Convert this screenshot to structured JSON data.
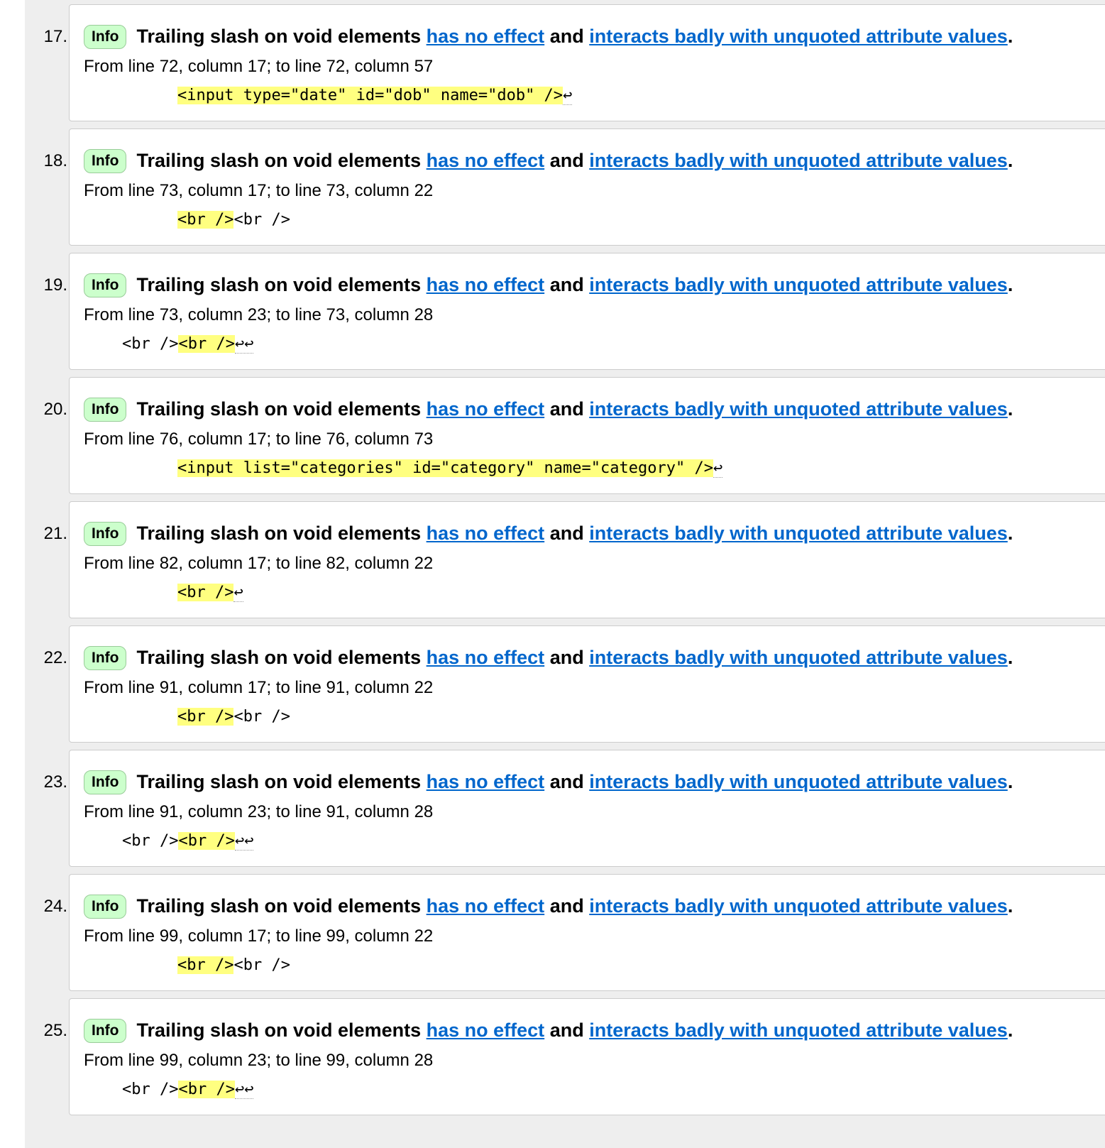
{
  "messages": [
    {
      "number": "17.",
      "badge": "Info",
      "text_prefix": "Trailing slash on void elements",
      "link1": "has no effect",
      "text_mid": "and",
      "link2": "interacts badly with unquoted attribute values",
      "text_suffix": ".",
      "location": "From line 72, column 17; to line 72, column 57",
      "extract_before": "",
      "extract_highlight": "<input type=\"date\" id=\"dob\" name=\"dob\" />",
      "extract_after": "↩"
    },
    {
      "number": "18.",
      "badge": "Info",
      "text_prefix": "Trailing slash on void elements",
      "link1": "has no effect",
      "text_mid": "and",
      "link2": "interacts badly with unquoted attribute values",
      "text_suffix": ".",
      "location": "From line 73, column 17; to line 73, column 22",
      "extract_before": "",
      "extract_highlight": "<br />",
      "extract_after": "<br />"
    },
    {
      "number": "19.",
      "badge": "Info",
      "text_prefix": "Trailing slash on void elements",
      "link1": "has no effect",
      "text_mid": "and",
      "link2": "interacts badly with unquoted attribute values",
      "text_suffix": ".",
      "location": "From line 73, column 23; to line 73, column 28",
      "extract_before": "<br />",
      "extract_highlight": "<br />",
      "extract_after": "↩↩"
    },
    {
      "number": "20.",
      "badge": "Info",
      "text_prefix": "Trailing slash on void elements",
      "link1": "has no effect",
      "text_mid": "and",
      "link2": "interacts badly with unquoted attribute values",
      "text_suffix": ".",
      "location": "From line 76, column 17; to line 76, column 73",
      "extract_before": "",
      "extract_highlight": "<input list=\"categories\" id=\"category\" name=\"category\" />",
      "extract_after": "↩"
    },
    {
      "number": "21.",
      "badge": "Info",
      "text_prefix": "Trailing slash on void elements",
      "link1": "has no effect",
      "text_mid": "and",
      "link2": "interacts badly with unquoted attribute values",
      "text_suffix": ".",
      "location": "From line 82, column 17; to line 82, column 22",
      "extract_before": "",
      "extract_highlight": "<br />",
      "extract_after": "↩"
    },
    {
      "number": "22.",
      "badge": "Info",
      "text_prefix": "Trailing slash on void elements",
      "link1": "has no effect",
      "text_mid": "and",
      "link2": "interacts badly with unquoted attribute values",
      "text_suffix": ".",
      "location": "From line 91, column 17; to line 91, column 22",
      "extract_before": "",
      "extract_highlight": "<br />",
      "extract_after": "<br />"
    },
    {
      "number": "23.",
      "badge": "Info",
      "text_prefix": "Trailing slash on void elements",
      "link1": "has no effect",
      "text_mid": "and",
      "link2": "interacts badly with unquoted attribute values",
      "text_suffix": ".",
      "location": "From line 91, column 23; to line 91, column 28",
      "extract_before": "<br />",
      "extract_highlight": "<br />",
      "extract_after": "↩↩"
    },
    {
      "number": "24.",
      "badge": "Info",
      "text_prefix": "Trailing slash on void elements",
      "link1": "has no effect",
      "text_mid": "and",
      "link2": "interacts badly with unquoted attribute values",
      "text_suffix": ".",
      "location": "From line 99, column 17; to line 99, column 22",
      "extract_before": "",
      "extract_highlight": "<br />",
      "extract_after": "<br />"
    },
    {
      "number": "25.",
      "badge": "Info",
      "text_prefix": "Trailing slash on void elements",
      "link1": "has no effect",
      "text_mid": "and",
      "link2": "interacts badly with unquoted attribute values",
      "text_suffix": ".",
      "location": "From line 99, column 23; to line 99, column 28",
      "extract_before": "<br />",
      "extract_highlight": "<br />",
      "extract_after": "↩↩"
    }
  ],
  "colors": {
    "link": "#0066cc",
    "badge_bg": "#ccffcc",
    "highlight": "#ffff80",
    "gutter": "#eeeeee"
  }
}
